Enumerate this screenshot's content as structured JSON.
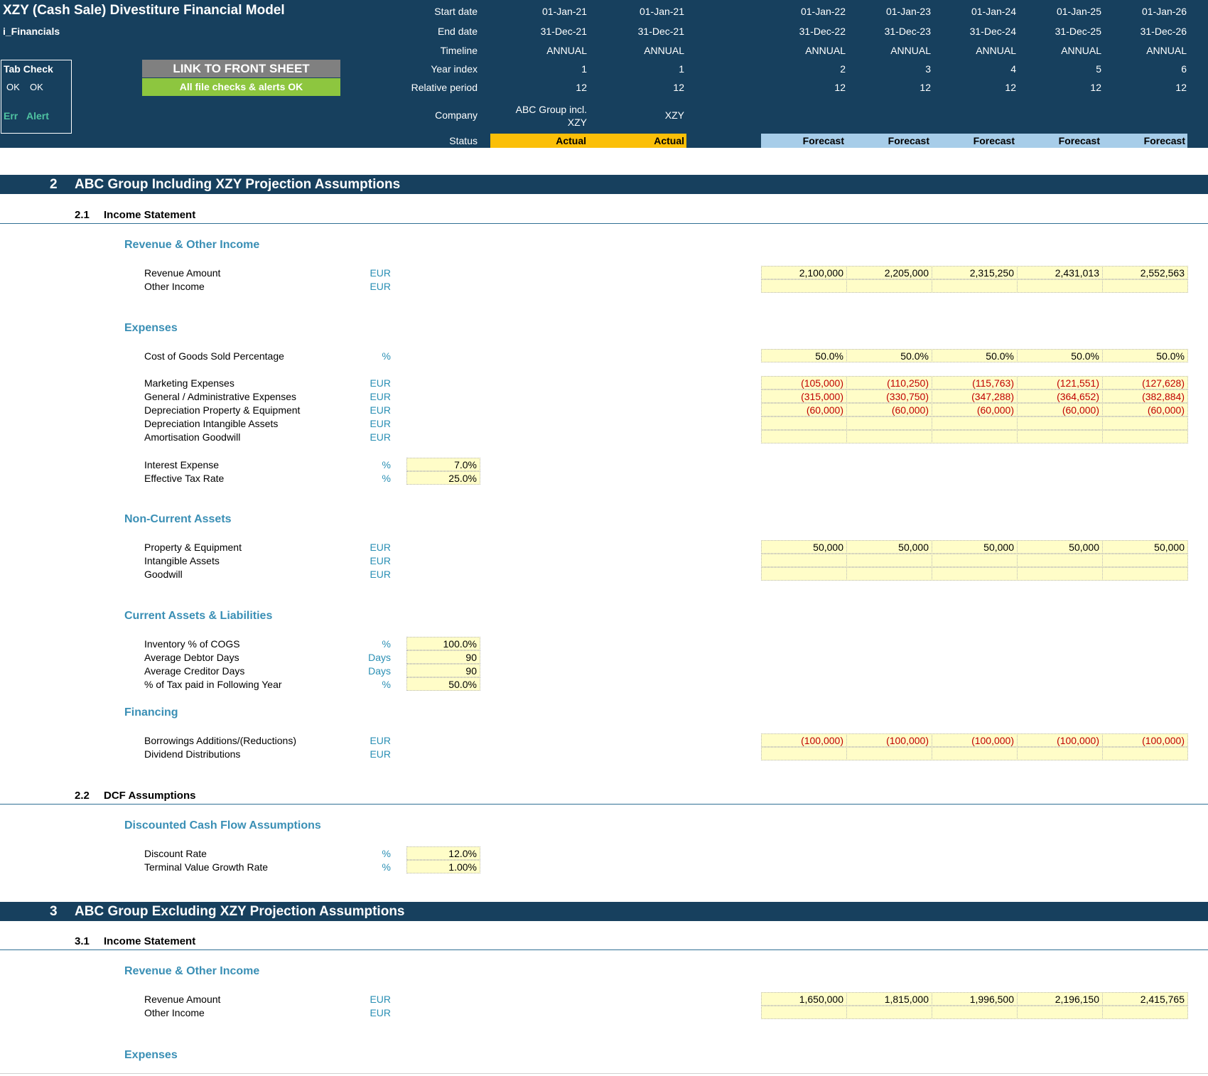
{
  "header": {
    "title": "XZY (Cash Sale) Divestiture Financial Model",
    "sheet": "i_Financials",
    "tab_check": {
      "title": "Tab Check",
      "ok1": "OK",
      "ok2": "OK",
      "err": "Err",
      "alert": "Alert"
    },
    "link_button": "LINK TO FRONT SHEET",
    "checks_status": "All file checks & alerts OK",
    "row_labels": {
      "start": "Start date",
      "end": "End date",
      "timeline": "Timeline",
      "year_index": "Year index",
      "relative": "Relative period",
      "company": "Company",
      "status": "Status"
    },
    "columns": [
      {
        "start": "01-Jan-21",
        "end": "31-Dec-21",
        "timeline": "ANNUAL",
        "year_index": "1",
        "relative": "12",
        "company": "ABC Group incl. XZY",
        "status": "Actual"
      },
      {
        "start": "01-Jan-21",
        "end": "31-Dec-21",
        "timeline": "ANNUAL",
        "year_index": "1",
        "relative": "12",
        "company": "XZY",
        "status": "Actual"
      },
      {
        "start": "01-Jan-22",
        "end": "31-Dec-22",
        "timeline": "ANNUAL",
        "year_index": "2",
        "relative": "12",
        "company": "",
        "status": "Forecast"
      },
      {
        "start": "01-Jan-23",
        "end": "31-Dec-23",
        "timeline": "ANNUAL",
        "year_index": "3",
        "relative": "12",
        "company": "",
        "status": "Forecast"
      },
      {
        "start": "01-Jan-24",
        "end": "31-Dec-24",
        "timeline": "ANNUAL",
        "year_index": "4",
        "relative": "12",
        "company": "",
        "status": "Forecast"
      },
      {
        "start": "01-Jan-25",
        "end": "31-Dec-25",
        "timeline": "ANNUAL",
        "year_index": "5",
        "relative": "12",
        "company": "",
        "status": "Forecast"
      },
      {
        "start": "01-Jan-26",
        "end": "31-Dec-26",
        "timeline": "ANNUAL",
        "year_index": "6",
        "relative": "12",
        "company": "",
        "status": "Forecast"
      }
    ]
  },
  "sections": {
    "s2": {
      "num": "2",
      "title": "ABC Group Including XZY Projection Assumptions"
    },
    "s2_1": {
      "num": "2.1",
      "title": "Income Statement"
    },
    "s2_2": {
      "num": "2.2",
      "title": "DCF Assumptions"
    },
    "s3": {
      "num": "3",
      "title": "ABC Group Excluding XZY Projection Assumptions"
    },
    "s3_1": {
      "num": "3.1",
      "title": "Income Statement"
    }
  },
  "groups": {
    "rev": "Revenue & Other Income",
    "exp": "Expenses",
    "nca": "Non-Current Assets",
    "cal": "Current Assets & Liabilities",
    "fin": "Financing",
    "dcf": "Discounted Cash Flow Assumptions",
    "rev3": "Revenue & Other Income",
    "exp3": "Expenses"
  },
  "rows": {
    "revenue": {
      "label": "Revenue Amount",
      "unit": "EUR",
      "values": [
        "2,100,000",
        "2,205,000",
        "2,315,250",
        "2,431,013",
        "2,552,563"
      ]
    },
    "other_income": {
      "label": "Other Income",
      "unit": "EUR"
    },
    "cogs": {
      "label": "Cost of Goods Sold Percentage",
      "unit": "%",
      "values": [
        "50.0%",
        "50.0%",
        "50.0%",
        "50.0%",
        "50.0%"
      ]
    },
    "marketing": {
      "label": "Marketing Expenses",
      "unit": "EUR",
      "values": [
        "(105,000)",
        "(110,250)",
        "(115,763)",
        "(121,551)",
        "(127,628)"
      ]
    },
    "ga": {
      "label": "General / Administrative Expenses",
      "unit": "EUR",
      "values": [
        "(315,000)",
        "(330,750)",
        "(347,288)",
        "(364,652)",
        "(382,884)"
      ]
    },
    "dep_pe": {
      "label": "Depreciation Property & Equipment",
      "unit": "EUR",
      "values": [
        "(60,000)",
        "(60,000)",
        "(60,000)",
        "(60,000)",
        "(60,000)"
      ]
    },
    "dep_ia": {
      "label": "Depreciation Intangible Assets",
      "unit": "EUR"
    },
    "amort_gw": {
      "label": "Amortisation Goodwill",
      "unit": "EUR"
    },
    "interest": {
      "label": "Interest Expense",
      "unit": "%",
      "value": "7.0%"
    },
    "tax": {
      "label": "Effective Tax Rate",
      "unit": "%",
      "value": "25.0%"
    },
    "pe": {
      "label": "Property & Equipment",
      "unit": "EUR",
      "values": [
        "50,000",
        "50,000",
        "50,000",
        "50,000",
        "50,000"
      ]
    },
    "ia": {
      "label": "Intangible Assets",
      "unit": "EUR"
    },
    "gw": {
      "label": "Goodwill",
      "unit": "EUR"
    },
    "inventory": {
      "label": "Inventory % of COGS",
      "unit": "%",
      "value": "100.0%"
    },
    "debtor": {
      "label": "Average Debtor Days",
      "unit": "Days",
      "value": "90"
    },
    "creditor": {
      "label": "Average Creditor Days",
      "unit": "Days",
      "value": "90"
    },
    "taxpaid": {
      "label": "% of Tax paid in Following Year",
      "unit": "%",
      "value": "50.0%"
    },
    "borrow": {
      "label": "Borrowings Additions/(Reductions)",
      "unit": "EUR",
      "values": [
        "(100,000)",
        "(100,000)",
        "(100,000)",
        "(100,000)",
        "(100,000)"
      ]
    },
    "dividend": {
      "label": "Dividend Distributions",
      "unit": "EUR"
    },
    "discount": {
      "label": "Discount Rate",
      "unit": "%",
      "value": "12.0%"
    },
    "tvgr": {
      "label": "Terminal Value Growth Rate",
      "unit": "%",
      "value": "1.00%"
    },
    "revenue3": {
      "label": "Revenue Amount",
      "unit": "EUR",
      "values": [
        "1,650,000",
        "1,815,000",
        "1,996,500",
        "2,196,150",
        "2,415,765"
      ]
    },
    "other_income3": {
      "label": "Other Income",
      "unit": "EUR"
    }
  }
}
